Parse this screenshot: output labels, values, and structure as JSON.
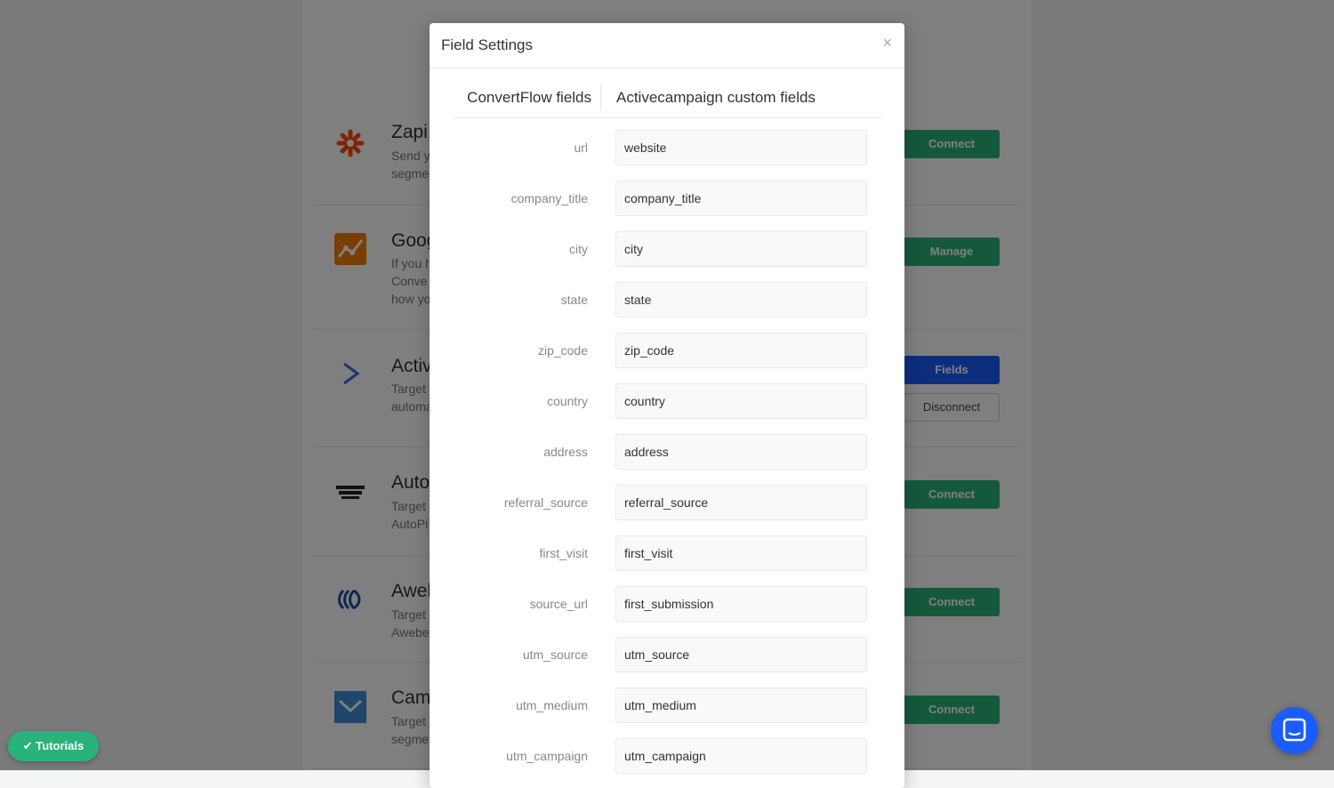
{
  "integrations": [
    {
      "title": "Zapi",
      "desc_lines": [
        "Send y",
        "segme"
      ],
      "button": "Connect",
      "icon": "zapier-icon"
    },
    {
      "title": "Goog",
      "desc_lines": [
        "If you h",
        "Conve",
        "how yo"
      ],
      "button": "Manage",
      "icon": "google-analytics-icon"
    },
    {
      "title": "Activ",
      "desc_lines": [
        "Target",
        "automa"
      ],
      "button": "Fields",
      "button2": "Disconnect",
      "icon": "activecampaign-icon"
    },
    {
      "title": "Auto",
      "desc_lines": [
        "Target",
        "AutoPi"
      ],
      "button": "Connect",
      "icon": "autopilot-icon"
    },
    {
      "title": "Awel",
      "desc_lines": [
        "Target",
        "Awebe"
      ],
      "button": "Connect",
      "icon": "aweber-icon"
    },
    {
      "title": "Cam",
      "desc_lines": [
        "Target",
        "segme"
      ],
      "button": "Connect",
      "icon": "campaign-monitor-icon"
    }
  ],
  "modal": {
    "title": "Field Settings",
    "close": "×",
    "col_left": "ConvertFlow fields",
    "col_right": "Activecampaign custom fields",
    "fields": [
      {
        "label": "url",
        "value": "website"
      },
      {
        "label": "company_title",
        "value": "company_title"
      },
      {
        "label": "city",
        "value": "city"
      },
      {
        "label": "state",
        "value": "state"
      },
      {
        "label": "zip_code",
        "value": "zip_code"
      },
      {
        "label": "country",
        "value": "country"
      },
      {
        "label": "address",
        "value": "address"
      },
      {
        "label": "referral_source",
        "value": "referral_source"
      },
      {
        "label": "first_visit",
        "value": "first_visit"
      },
      {
        "label": "source_url",
        "value": "first_submission"
      },
      {
        "label": "utm_source",
        "value": "utm_source"
      },
      {
        "label": "utm_medium",
        "value": "utm_medium"
      },
      {
        "label": "utm_campaign",
        "value": "utm_campaign"
      }
    ]
  },
  "tutorials_label": "Tutorials",
  "colors": {
    "green": "#2ab27b",
    "blue": "#1a5cff"
  }
}
